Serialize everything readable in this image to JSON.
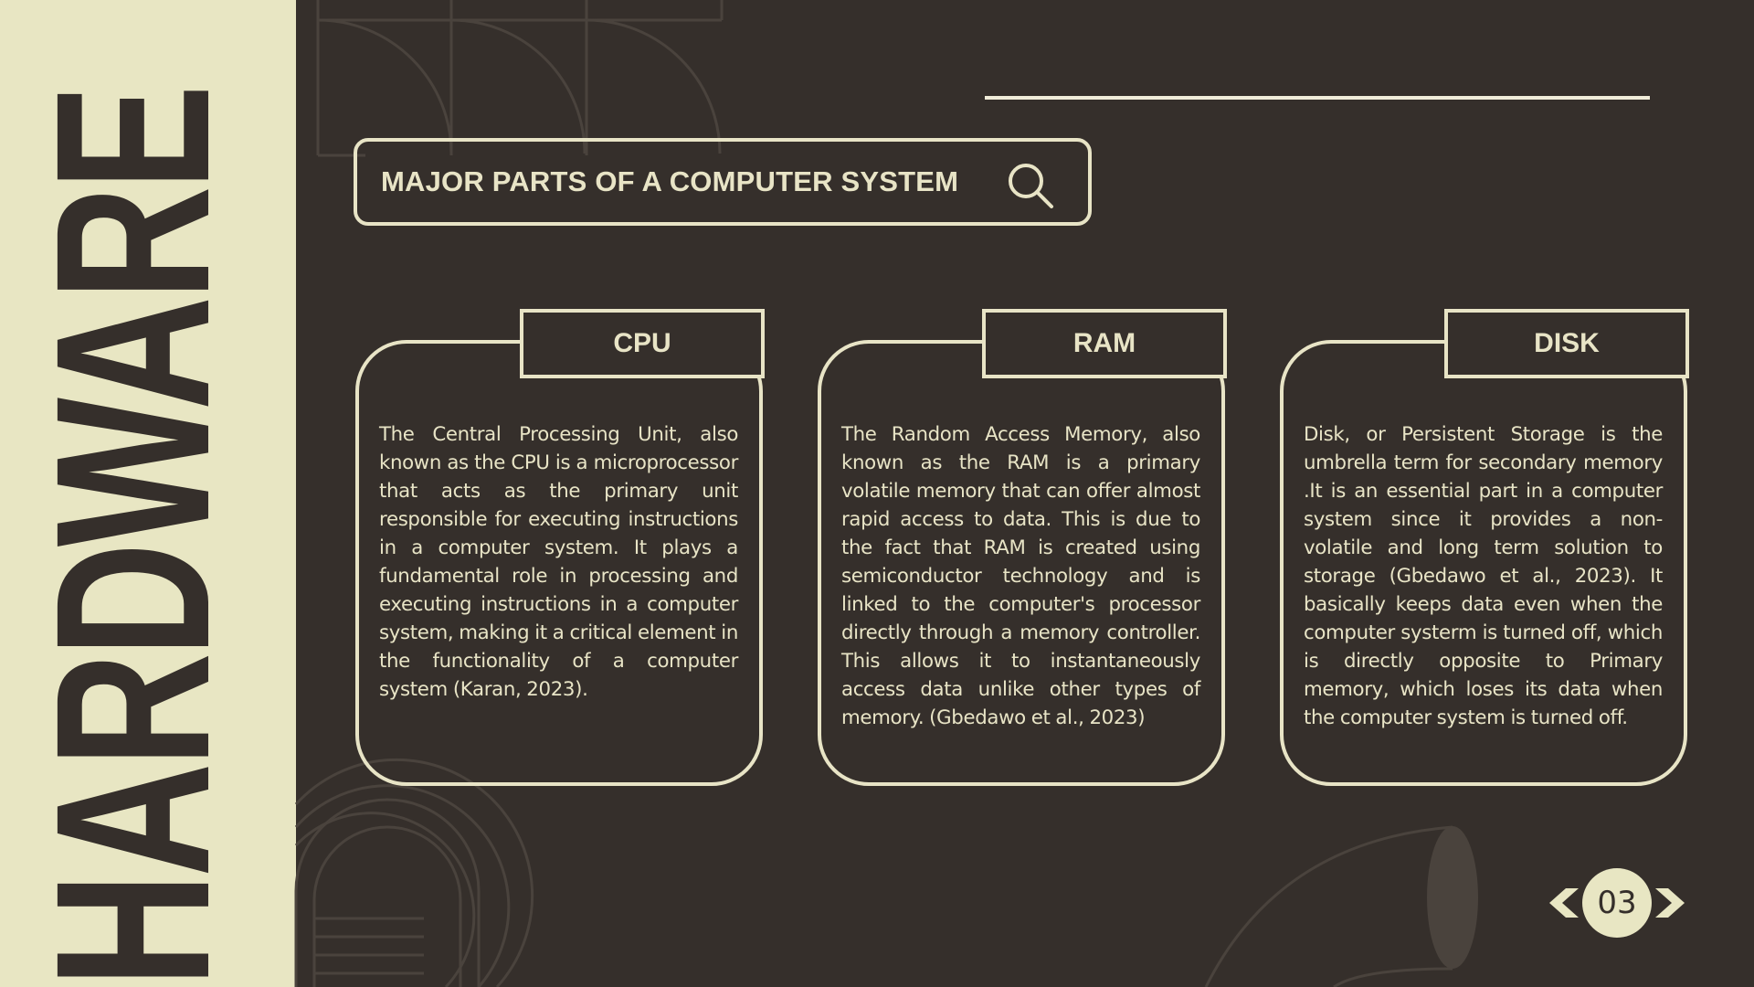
{
  "sidebar": {
    "title": "HARDWARE"
  },
  "header": {
    "title": "MAJOR PARTS OF A COMPUTER SYSTEM",
    "icon": "search-icon"
  },
  "cards": [
    {
      "title": "CPU",
      "text": "The Central Processing Unit, also known as the CPU is a microprocessor that acts as the primary unit responsible for executing instructions in a computer system. It plays a  fundamental role in processing and executing instructions in a computer system, making it a critical  element in the functionality of a computer system (Karan,  2023)."
    },
    {
      "title": "RAM",
      "text": "The Random Access Memory, also known as the RAM is a primary volatile memory that can offer almost rapid access to data. This is due to the fact that RAM is created using semiconductor technology and is linked to the computer's processor directly through a memory controller. This allows it to instantaneously access data unlike other types of memory. (Gbedawo et al., 2023)"
    },
    {
      "title": "DISK",
      "text": "Disk, or Persistent Storage is the umbrella term for secondary memory .It is an essential part in a computer system since it provides a non-volatile and long term solution to storage (Gbedawo et al., 2023). It basically keeps data even when the computer systerm is turned off, which is directly opposite to  Primary memory, which loses its data when the computer system is turned off."
    }
  ],
  "pager": {
    "page": "03",
    "prev_icon": "chevron-left-icon",
    "next_icon": "chevron-right-icon"
  },
  "colors": {
    "background": "#352f2b",
    "accent": "#e8e4c6",
    "band": "#e8e6c3"
  }
}
